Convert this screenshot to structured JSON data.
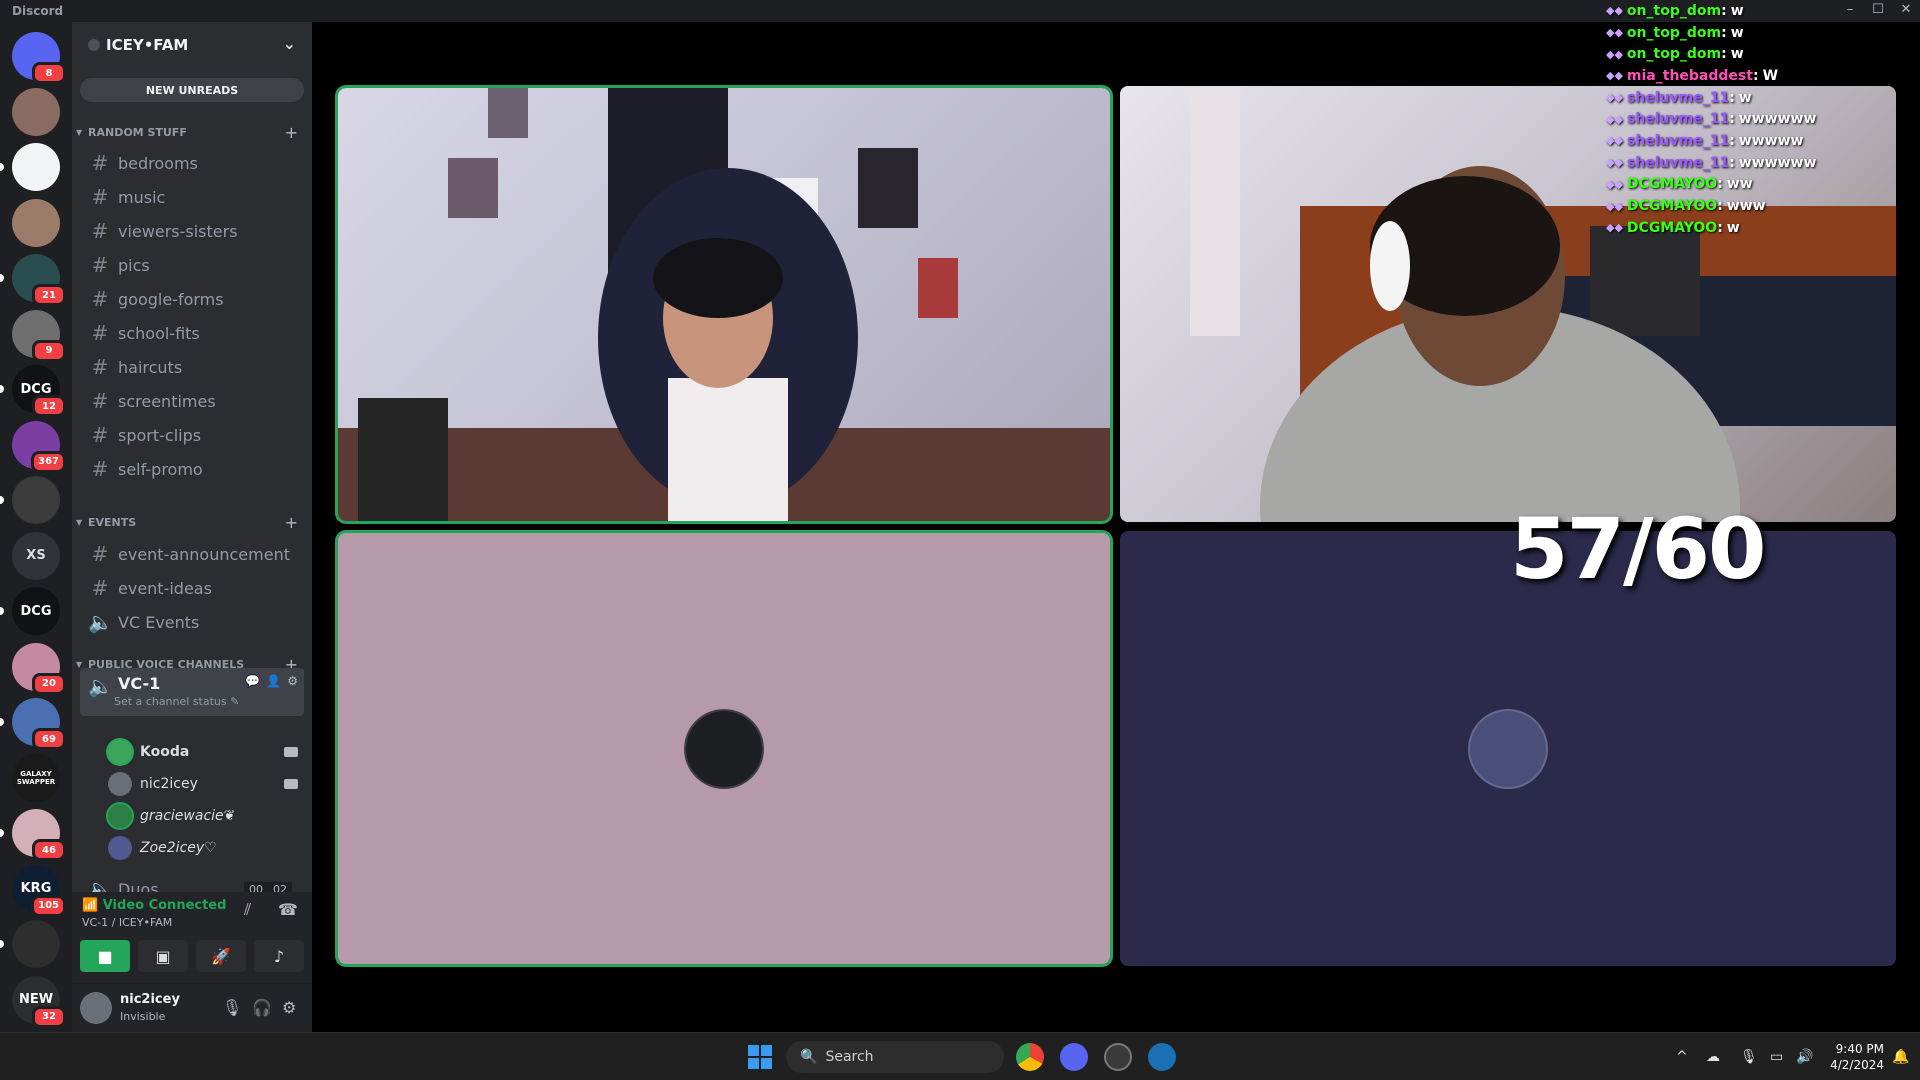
{
  "window": {
    "app_name": "Discord",
    "controls": [
      "–",
      "☐",
      "✕"
    ]
  },
  "servers": [
    {
      "label": "",
      "badge": "8",
      "color": "#5865f2"
    },
    {
      "label": "",
      "badge": "",
      "color": "#8a6b62"
    },
    {
      "label": "",
      "badge": "",
      "color": "#f2f3f5"
    },
    {
      "label": "",
      "badge": "",
      "color": "#9a7b68"
    },
    {
      "label": "",
      "badge": "21",
      "color": "#2a4d4f"
    },
    {
      "label": "",
      "badge": "9",
      "color": "#6e6e6e"
    },
    {
      "label": "DCG",
      "badge": "12",
      "color": "#111214"
    },
    {
      "label": "",
      "badge": "367",
      "color": "#7b3fa3"
    },
    {
      "label": "",
      "badge": "",
      "color": "#3b3b3b"
    },
    {
      "label": "XS",
      "badge": "",
      "color": "#313338"
    },
    {
      "label": "DCG",
      "badge": "",
      "color": "#111214"
    },
    {
      "label": "",
      "badge": "20",
      "color": "#c58aa0"
    },
    {
      "label": "",
      "badge": "69",
      "color": "#4a6fb3"
    },
    {
      "label": "GALAXY SWAPPER",
      "badge": "",
      "color": "#1a1a1a"
    },
    {
      "label": "",
      "badge": "46",
      "color": "#d3b0b8"
    },
    {
      "label": "KRG",
      "badge": "105",
      "color": "#0f1f33"
    },
    {
      "label": "",
      "badge": "",
      "color": "#2e2e2e"
    },
    {
      "label": "NEW",
      "badge": "32",
      "color": "#2b2d31"
    }
  ],
  "guild": {
    "name": "ICEY•FAM",
    "new_unreads": "NEW UNREADS"
  },
  "categories": {
    "random": "RANDOM STUFF",
    "events": "EVENTS",
    "voice": "PUBLIC VOICE CHANNELS"
  },
  "random_channels": [
    "bedrooms",
    "music",
    "viewers-sisters",
    "pics",
    "google-forms",
    "school-fits",
    "haircuts",
    "screentimes",
    "sport-clips",
    "self-promo"
  ],
  "event_channels": [
    "event-announcement",
    "event-ideas",
    "VC Events"
  ],
  "voice_channel": {
    "name": "VC-1",
    "status_prompt": "Set a channel status",
    "users": [
      {
        "name": "Kooda",
        "camera": true
      },
      {
        "name": "nic2icey",
        "camera": true
      },
      {
        "name": "graciewacie❦",
        "camera": false
      },
      {
        "name": "Zoe2icey♡",
        "camera": false
      }
    ]
  },
  "duos": {
    "name": "Duos",
    "count_a": "00",
    "count_b": "02"
  },
  "voice_panel": {
    "status": "Video Connected",
    "location": "VC-1 / ICEY•FAM"
  },
  "user_panel": {
    "name": "nic2icey",
    "status": "Invisible"
  },
  "stream_overlay": {
    "counter": "57/60"
  },
  "chat": [
    {
      "user": "on_top_dom",
      "msg": "w",
      "color": "#39ff14"
    },
    {
      "user": "on_top_dom",
      "msg": "w",
      "color": "#39ff14"
    },
    {
      "user": "on_top_dom",
      "msg": "w",
      "color": "#39ff14"
    },
    {
      "user": "mia_thebaddest",
      "msg": "W",
      "color": "#ff4fb8"
    },
    {
      "user": "sheluvme_11",
      "msg": "w",
      "color": "#9b59ff"
    },
    {
      "user": "sheluvme_11",
      "msg": "wwwwww",
      "color": "#9b59ff"
    },
    {
      "user": "sheluvme_11",
      "msg": "wwwww",
      "color": "#9b59ff"
    },
    {
      "user": "sheluvme_11",
      "msg": "wwwwww",
      "color": "#9b59ff"
    },
    {
      "user": "DCGMAYOO",
      "msg": "ww",
      "color": "#39ff14"
    },
    {
      "user": "DCGMAYOO",
      "msg": "www",
      "color": "#39ff14"
    },
    {
      "user": "DCGMAYOO",
      "msg": "w",
      "color": "#39ff14"
    }
  ],
  "taskbar": {
    "search_placeholder": "Search",
    "time": "9:40 PM",
    "date": "4/2/2024"
  },
  "colors": {
    "speaking": "#23a55a",
    "tile_pink": "#b79aaa",
    "tile_navy": "#2b2a4b"
  }
}
